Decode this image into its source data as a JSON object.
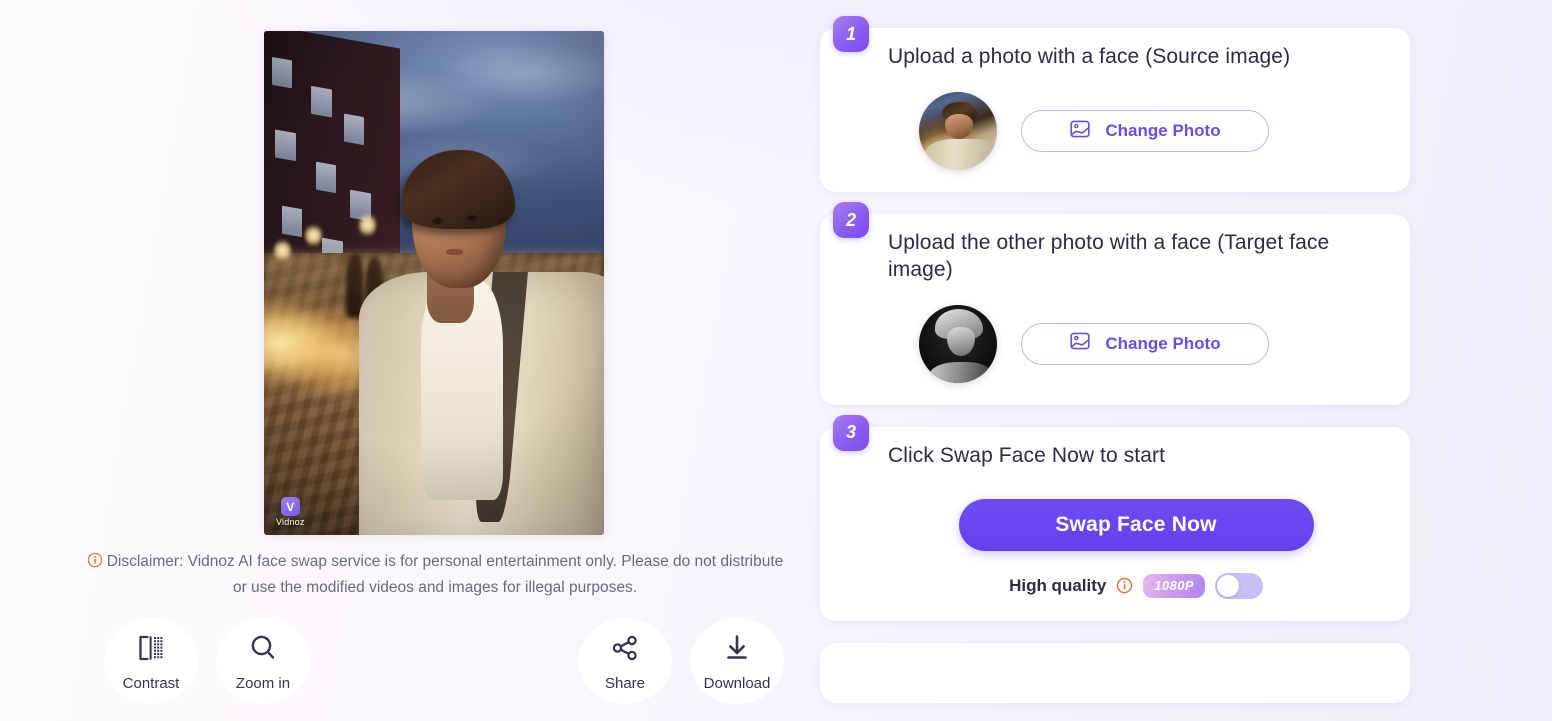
{
  "app": {
    "name": "Vidnoz AI Face Swap",
    "watermark": "Vidnoz",
    "watermark_logo_glyph": "V",
    "accent": "#6340ef",
    "badge_gradient_from": "#a97ef2",
    "badge_gradient_to": "#7b4ced",
    "background": "#f7f4fb"
  },
  "preview": {
    "alt": "Night street portrait of a young man in a beige suit",
    "watermark": "Vidnoz"
  },
  "disclaimer": {
    "icon": "info-circle-icon",
    "icon_color": "#e4714a",
    "text": "Disclaimer: Vidnoz AI face swap service is for personal entertainment only. Please do not distribute or use the modified videos and images for illegal purposes."
  },
  "toolbar": {
    "left": [
      {
        "id": "contrast",
        "label": "Contrast",
        "icon": "contrast-icon"
      },
      {
        "id": "zoom-in",
        "label": "Zoom in",
        "icon": "magnifier-icon"
      }
    ],
    "right": [
      {
        "id": "share",
        "label": "Share",
        "icon": "share-icon"
      },
      {
        "id": "download",
        "label": "Download",
        "icon": "download-icon"
      }
    ]
  },
  "steps": [
    {
      "number": "1",
      "title": "Upload a photo with a face (Source image)",
      "avatar_alt": "Source face thumbnail",
      "avatar_kind": "color-street-portrait",
      "button_label": "Change Photo",
      "button_icon": "image-icon"
    },
    {
      "number": "2",
      "title": "Upload the other photo with a face (Target face image)",
      "avatar_alt": "Target face thumbnail",
      "avatar_kind": "black-and-white-portrait",
      "button_label": "Change Photo",
      "button_icon": "image-icon"
    },
    {
      "number": "3",
      "title": "Click Swap Face Now to start",
      "primary_button_label": "Swap Face Now",
      "quality": {
        "label": "High quality",
        "info_icon": "info-circle-icon",
        "resolution_badge": "1080P",
        "toggle_state": "off"
      }
    }
  ]
}
